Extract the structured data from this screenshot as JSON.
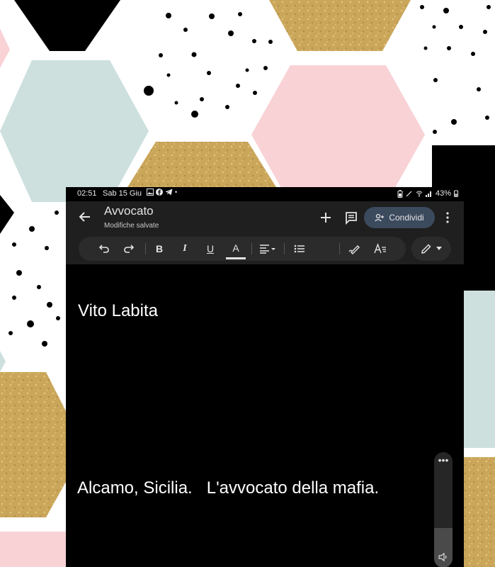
{
  "status_bar": {
    "time": "02:51",
    "date": "Sab 15 Giu",
    "battery": "43%"
  },
  "document": {
    "title": "Avvocato",
    "save_status": "Modifiche salvate"
  },
  "actions": {
    "share_label": "Condividi"
  },
  "toolbar": {
    "bold": "B",
    "italic": "I",
    "underline": "U",
    "text_color": "A"
  },
  "content": {
    "line1": "Vito Labita",
    "line2": "Alcamo, Sicilia.   L'avvocato della mafia."
  },
  "colors": {
    "background": "#000000",
    "app_bar": "#1f1f1f",
    "share_button": "#3c4a5e",
    "text": "#ffffff"
  },
  "icons": [
    "back-arrow-icon",
    "plus-icon",
    "comment-icon",
    "add-person-icon",
    "more-vert-icon",
    "undo-icon",
    "redo-icon",
    "align-icon",
    "list-icon",
    "pen-icon",
    "text-format-icon",
    "edit-pencil-icon",
    "volume-icon"
  ]
}
